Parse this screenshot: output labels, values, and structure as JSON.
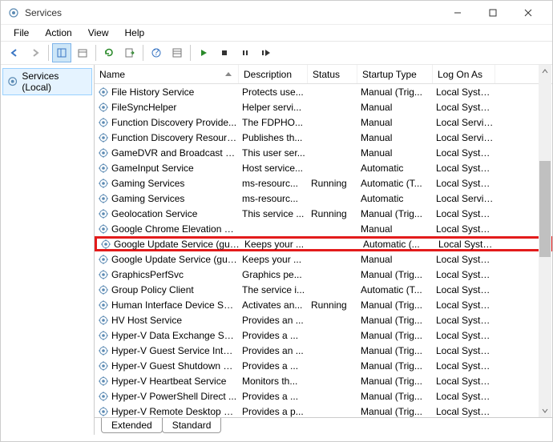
{
  "window": {
    "title": "Services"
  },
  "menu": {
    "file": "File",
    "action": "Action",
    "view": "View",
    "help": "Help"
  },
  "tree": {
    "root": "Services (Local)"
  },
  "columns": {
    "name": "Name",
    "description": "Description",
    "status": "Status",
    "startup": "Startup Type",
    "logon": "Log On As"
  },
  "tabs": {
    "extended": "Extended",
    "standard": "Standard"
  },
  "services": [
    {
      "name": "File History Service",
      "desc": "Protects use...",
      "status": "",
      "startup": "Manual (Trig...",
      "logon": "Local Syste..."
    },
    {
      "name": "FileSyncHelper",
      "desc": "Helper servi...",
      "status": "",
      "startup": "Manual",
      "logon": "Local Syste..."
    },
    {
      "name": "Function Discovery Provide...",
      "desc": "The FDPHO...",
      "status": "",
      "startup": "Manual",
      "logon": "Local Service"
    },
    {
      "name": "Function Discovery Resourc...",
      "desc": "Publishes th...",
      "status": "",
      "startup": "Manual",
      "logon": "Local Service"
    },
    {
      "name": "GameDVR and Broadcast Us...",
      "desc": "This user ser...",
      "status": "",
      "startup": "Manual",
      "logon": "Local Syste..."
    },
    {
      "name": "GameInput Service",
      "desc": "Host service...",
      "status": "",
      "startup": "Automatic",
      "logon": "Local Syste..."
    },
    {
      "name": "Gaming Services",
      "desc": "ms-resourc...",
      "status": "Running",
      "startup": "Automatic (T...",
      "logon": "Local Syste..."
    },
    {
      "name": "Gaming Services",
      "desc": "ms-resourc...",
      "status": "",
      "startup": "Automatic",
      "logon": "Local Service"
    },
    {
      "name": "Geolocation Service",
      "desc": "This service ...",
      "status": "Running",
      "startup": "Manual (Trig...",
      "logon": "Local Syste..."
    },
    {
      "name": "Google Chrome Elevation S...",
      "desc": "",
      "status": "",
      "startup": "Manual",
      "logon": "Local Syste..."
    },
    {
      "name": "Google Update Service (gup...",
      "desc": "Keeps your ...",
      "status": "",
      "startup": "Automatic (...",
      "logon": "Local Syste...",
      "highlight": true
    },
    {
      "name": "Google Update Service (gup...",
      "desc": "Keeps your ...",
      "status": "",
      "startup": "Manual",
      "logon": "Local Syste..."
    },
    {
      "name": "GraphicsPerfSvc",
      "desc": "Graphics pe...",
      "status": "",
      "startup": "Manual (Trig...",
      "logon": "Local Syste..."
    },
    {
      "name": "Group Policy Client",
      "desc": "The service i...",
      "status": "",
      "startup": "Automatic (T...",
      "logon": "Local Syste..."
    },
    {
      "name": "Human Interface Device Ser...",
      "desc": "Activates an...",
      "status": "Running",
      "startup": "Manual (Trig...",
      "logon": "Local Syste..."
    },
    {
      "name": "HV Host Service",
      "desc": "Provides an ...",
      "status": "",
      "startup": "Manual (Trig...",
      "logon": "Local Syste..."
    },
    {
      "name": "Hyper-V Data Exchange Ser...",
      "desc": "Provides a ...",
      "status": "",
      "startup": "Manual (Trig...",
      "logon": "Local Syste..."
    },
    {
      "name": "Hyper-V Guest Service Inter...",
      "desc": "Provides an ...",
      "status": "",
      "startup": "Manual (Trig...",
      "logon": "Local Syste..."
    },
    {
      "name": "Hyper-V Guest Shutdown S...",
      "desc": "Provides a ...",
      "status": "",
      "startup": "Manual (Trig...",
      "logon": "Local Syste..."
    },
    {
      "name": "Hyper-V Heartbeat Service",
      "desc": "Monitors th...",
      "status": "",
      "startup": "Manual (Trig...",
      "logon": "Local Syste..."
    },
    {
      "name": "Hyper-V PowerShell Direct ...",
      "desc": "Provides a ...",
      "status": "",
      "startup": "Manual (Trig...",
      "logon": "Local Syste..."
    },
    {
      "name": "Hyper-V Remote Desktop Vi...",
      "desc": "Provides a p...",
      "status": "",
      "startup": "Manual (Trig...",
      "logon": "Local Syste..."
    }
  ]
}
